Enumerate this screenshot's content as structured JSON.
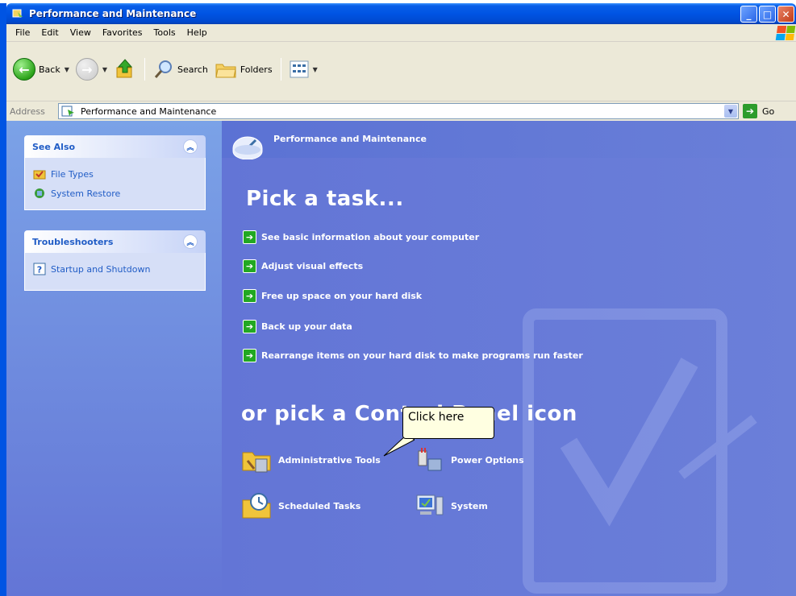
{
  "window": {
    "title": "Performance and Maintenance",
    "controls": [
      "minimize",
      "maximize",
      "close"
    ]
  },
  "menu": {
    "items": [
      "File",
      "Edit",
      "View",
      "Favorites",
      "Tools",
      "Help"
    ]
  },
  "toolbar": {
    "back_label": "Back",
    "search_label": "Search",
    "folders_label": "Folders"
  },
  "address": {
    "label": "Address",
    "value": "Performance and Maintenance",
    "go_label": "Go"
  },
  "see_also": {
    "title": "See Also",
    "items": [
      {
        "label": "File Types",
        "icon": "file-types-icon"
      },
      {
        "label": "System Restore",
        "icon": "system-restore-icon"
      }
    ]
  },
  "troubleshooters": {
    "title": "Troubleshooters",
    "items": [
      {
        "label": "Startup and Shutdown",
        "icon": "help-icon"
      }
    ]
  },
  "category": {
    "title": "Performance and Maintenance"
  },
  "tasks": {
    "heading": "Pick a task...",
    "items": [
      "See basic information about your computer",
      "Adjust visual effects",
      "Free up space on your hard disk",
      "Back up your data",
      "Rearrange items on your hard disk to make programs run faster"
    ]
  },
  "control_panel": {
    "heading": "or pick a Control Panel icon",
    "items": [
      {
        "label": "Administrative Tools",
        "icon": "administrative-tools-icon"
      },
      {
        "label": "Power Options",
        "icon": "power-options-icon"
      },
      {
        "label": "Scheduled Tasks",
        "icon": "scheduled-tasks-icon"
      },
      {
        "label": "System",
        "icon": "system-icon"
      }
    ]
  },
  "callout": {
    "text": "Click here"
  },
  "colors": {
    "titlebar": "#0054e3",
    "left_pane": "#6f8fdf",
    "right_pane": "#6375d6",
    "link": "#215dc6",
    "task_arrow": "#22a822",
    "callout_bg": "#ffffe1"
  }
}
